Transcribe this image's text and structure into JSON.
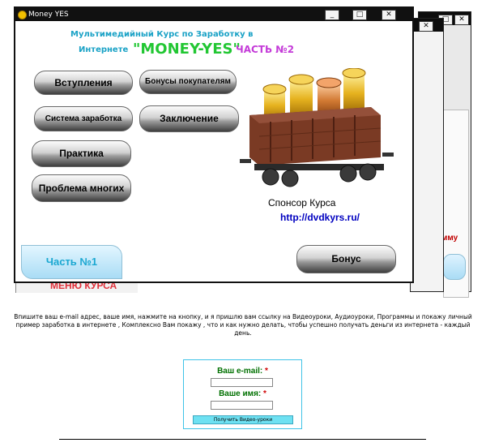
{
  "window": {
    "title": "Money YES",
    "minimize": "_",
    "maximize": "□",
    "close": "✕"
  },
  "heading": {
    "line1": "Мультимедийный Курс по Заработку в",
    "line2_prefix": "Интернете",
    "brand": "\"MONEY-YES\"",
    "part": "ЧАСТЬ №2"
  },
  "menu": [
    {
      "label": "Вступления"
    },
    {
      "label": "Бонусы покупателям"
    },
    {
      "label": "Система заработка"
    },
    {
      "label": "Заключение"
    },
    {
      "label": "Практика"
    },
    {
      "label": "Проблема многих"
    }
  ],
  "sponsor": {
    "label": "Спонсор Курса",
    "link": "http://dvdkyrs.ru/"
  },
  "bonus_button": "Бонус",
  "part1_button": "Часть №1",
  "background": {
    "menu_label": "МЕНЮ КУРСА",
    "partial_right": "мму"
  },
  "bottom": {
    "description": "Впишите ваш e-mail адрес, ваше имя, нажмите на кнопку, и я пришлю вам ссылку на Видеоуроки, Аудиоуроки, Программы и покажу личный пример заработка в интернете , Комплексно Вам покажу , что и как нужно делать, чтобы успешно получать деньги из интернета - каждый день.",
    "email_label": "Ваш e-mail:",
    "name_label": "Ваше имя:",
    "required_mark": "*",
    "submit_label": "Получить Видео-уроки"
  }
}
